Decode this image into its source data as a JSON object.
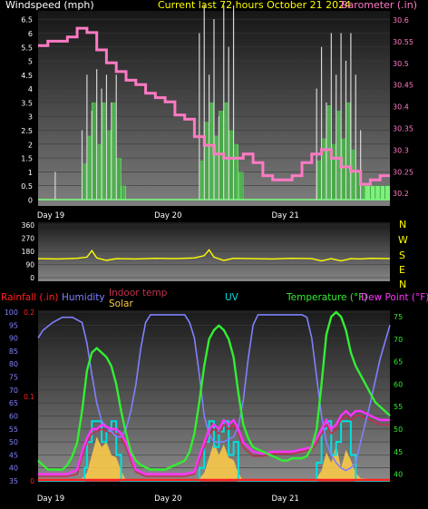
{
  "colors": {
    "wind_label": "#ffffff",
    "title": "#ffff00",
    "barometer": "#ff7ac4",
    "wind_gust": "#d8d8d8",
    "wind_avg": "#7cff7c",
    "direction": "#ffff00",
    "rain": "#ff2020",
    "humidity": "#8080ff",
    "indoor": "#c03050",
    "solar": "#ffcc44",
    "uv": "#00e0e0",
    "temperature": "#33ee33",
    "dewpoint": "#ff33ff"
  },
  "top_chart": {
    "wind_title": "Windspeed (mph)",
    "center_title": "Current last 72 hours October 21 2024",
    "baro_title": "Barometer (.in)"
  },
  "mid_chart": {
    "compass": [
      "N",
      "W",
      "S",
      "E",
      "N"
    ]
  },
  "bottom_chart": {
    "labels": {
      "rain": "Rainfall (.in)",
      "humidity": "Humidity",
      "indoor": "Indoor temp",
      "solar": "Solar",
      "uv": "UV",
      "temperature": "Temperature (°F)",
      "dewpoint": "Dew Point (°F)"
    }
  },
  "chart_data": [
    {
      "type": "line",
      "x_range_hours": [
        0,
        72
      ],
      "day_ticks": [
        {
          "label": "Day 19",
          "hour": 0
        },
        {
          "label": "Day 20",
          "hour": 24
        },
        {
          "label": "Day 21",
          "hour": 48
        }
      ],
      "y_left": {
        "ticks": [
          "0",
          "0.5",
          "1",
          "1.5",
          "2",
          "2.5",
          "3",
          "3.5",
          "4",
          "4.5",
          "5",
          "5.5",
          "6",
          "6.5"
        ],
        "ylim": [
          0,
          6.8
        ]
      },
      "y_right": {
        "ticks": [
          "30.2",
          "30.25",
          "30.3",
          "30.35",
          "30.4",
          "30.45",
          "30.5",
          "30.55",
          "30.6"
        ],
        "ylim": [
          30.17,
          30.62
        ]
      },
      "series": [
        {
          "name": "Barometer",
          "axis": "right",
          "x": [
            0,
            2,
            4,
            6,
            8,
            9,
            10,
            12,
            14,
            16,
            18,
            20,
            22,
            24,
            26,
            28,
            30,
            32,
            34,
            36,
            38,
            40,
            42,
            44,
            46,
            48,
            50,
            52,
            54,
            56,
            58,
            60,
            62,
            64,
            66,
            68,
            70,
            72
          ],
          "values": [
            30.54,
            30.55,
            30.55,
            30.56,
            30.58,
            30.58,
            30.57,
            30.53,
            30.5,
            30.48,
            30.46,
            30.45,
            30.43,
            30.42,
            30.41,
            30.38,
            30.37,
            30.33,
            30.31,
            30.29,
            30.28,
            30.28,
            30.29,
            30.27,
            30.24,
            30.23,
            30.23,
            30.24,
            30.27,
            30.29,
            30.3,
            30.28,
            30.26,
            30.25,
            30.22,
            30.23,
            30.24,
            30.24
          ]
        },
        {
          "name": "Wind average",
          "axis": "left",
          "x": [
            0,
            8,
            9,
            10,
            11,
            12,
            13,
            14,
            15,
            16,
            17,
            18,
            19,
            20,
            32,
            33,
            34,
            35,
            36,
            37,
            38,
            39,
            40,
            41,
            42,
            56,
            57,
            58,
            59,
            60,
            61,
            62,
            63,
            64,
            65,
            66,
            67,
            72
          ],
          "values": [
            0,
            0,
            1.3,
            2.3,
            3.5,
            2.0,
            3.5,
            2.5,
            3.5,
            1.5,
            0.5,
            0,
            0,
            0,
            0,
            1.4,
            2.8,
            3.5,
            2.3,
            3.2,
            3.5,
            2.5,
            2.0,
            1.0,
            0,
            0,
            1.4,
            2.2,
            3.4,
            2.0,
            3.2,
            2.2,
            3.5,
            1.8,
            1.0,
            0.6,
            0.5,
            0
          ]
        },
        {
          "name": "Wind gust",
          "axis": "left",
          "x": [
            3.5,
            9,
            10,
            11,
            12,
            13,
            14,
            15,
            16,
            33,
            34,
            35,
            36,
            37,
            38,
            39,
            40,
            57,
            58,
            59,
            60,
            61,
            62,
            63,
            64,
            65,
            66
          ],
          "values": [
            1.0,
            2.5,
            4.5,
            3.2,
            4.7,
            4.0,
            4.5,
            3.5,
            4.5,
            6.0,
            7.0,
            4.5,
            6.5,
            3.0,
            7.0,
            5.5,
            7.0,
            4.0,
            5.5,
            3.5,
            6.0,
            4.5,
            6.0,
            5.0,
            6.0,
            4.5,
            2.5
          ]
        }
      ]
    },
    {
      "type": "line",
      "x_range_hours": [
        0,
        72
      ],
      "y": {
        "ticks": [
          "360",
          "270",
          "180",
          "90",
          "0"
        ],
        "ylim": [
          0,
          360
        ]
      },
      "series": [
        {
          "name": "Wind direction",
          "x": [
            0,
            4,
            8,
            10,
            11,
            12,
            14,
            16,
            20,
            24,
            28,
            32,
            34,
            35,
            36,
            38,
            40,
            44,
            48,
            52,
            56,
            58,
            60,
            62,
            64,
            66,
            68,
            72
          ],
          "values": [
            130,
            128,
            132,
            140,
            185,
            135,
            118,
            130,
            128,
            132,
            130,
            135,
            150,
            190,
            140,
            118,
            132,
            130,
            128,
            132,
            130,
            115,
            130,
            115,
            130,
            128,
            132,
            130
          ]
        }
      ]
    },
    {
      "type": "line",
      "x_range_hours": [
        0,
        72
      ],
      "y_left": {
        "ticks": [
          "35",
          "40",
          "45",
          "50",
          "55",
          "60",
          "65",
          "70",
          "75",
          "80",
          "85",
          "90",
          "95",
          "100"
        ],
        "ylim": [
          35,
          100
        ]
      },
      "y_right": {
        "ticks": [
          "40",
          "45",
          "50",
          "55",
          "60",
          "65",
          "70",
          "75"
        ],
        "ylim": [
          38.5,
          76
        ]
      },
      "rain_axis": {
        "ticks": [
          "0",
          "0.1",
          "0.2"
        ]
      },
      "series": [
        {
          "name": "Humidity",
          "axis": "left",
          "x": [
            0,
            1,
            3,
            5,
            7,
            9,
            10,
            11,
            12,
            13,
            14,
            16,
            17,
            18,
            19,
            20,
            21,
            22,
            23,
            24,
            26,
            28,
            30,
            31,
            32,
            33,
            34,
            35,
            36,
            38,
            40,
            41,
            42,
            43,
            44,
            45,
            46,
            47,
            48,
            50,
            52,
            54,
            55,
            56,
            57,
            58,
            59,
            60,
            61,
            62,
            63,
            64,
            65,
            66,
            68,
            70,
            72
          ],
          "values": [
            90,
            93,
            96,
            98,
            98,
            96,
            88,
            76,
            65,
            58,
            56,
            52,
            52,
            55,
            62,
            72,
            86,
            96,
            99,
            99,
            99,
            99,
            99,
            96,
            90,
            76,
            60,
            53,
            50,
            50,
            52,
            56,
            66,
            82,
            95,
            99,
            99,
            99,
            99,
            99,
            99,
            99,
            98,
            90,
            75,
            60,
            50,
            45,
            42,
            40,
            39,
            40,
            42,
            50,
            65,
            82,
            95
          ]
        },
        {
          "name": "Temperature",
          "axis": "right",
          "x": [
            0,
            1,
            2,
            3,
            4,
            5,
            6,
            7,
            8,
            9,
            10,
            11,
            12,
            13,
            14,
            15,
            16,
            17,
            18,
            19,
            20,
            21,
            22,
            23,
            24,
            25,
            26,
            27,
            28,
            29,
            30,
            31,
            32,
            33,
            34,
            35,
            36,
            37,
            38,
            39,
            40,
            41,
            42,
            43,
            44,
            45,
            46,
            47,
            48,
            49,
            50,
            51,
            52,
            53,
            54,
            55,
            56,
            57,
            58,
            59,
            60,
            61,
            62,
            63,
            64,
            65,
            66,
            67,
            68,
            69,
            70,
            71,
            72
          ],
          "values": [
            43,
            42,
            41,
            41,
            41,
            41,
            42,
            44,
            47,
            54,
            63,
            67,
            68,
            67,
            66,
            64,
            60,
            54,
            49,
            45,
            43,
            42,
            41.5,
            41,
            41,
            41,
            41,
            41.5,
            42,
            42.5,
            43,
            45,
            49,
            56,
            64,
            70,
            72,
            73,
            72,
            70,
            66,
            58,
            51,
            48,
            46,
            45.5,
            45,
            44.5,
            44,
            43.5,
            43,
            43,
            43.5,
            43.5,
            43.5,
            44,
            46,
            50,
            60,
            71,
            75,
            76,
            75,
            72,
            67,
            64,
            62,
            60,
            58,
            56,
            55,
            54,
            53
          ]
        },
        {
          "name": "Dew Point",
          "axis": "right",
          "x": [
            0,
            2,
            4,
            6,
            8,
            9,
            10,
            11,
            12,
            13,
            14,
            15,
            16,
            17,
            18,
            19,
            20,
            22,
            24,
            26,
            28,
            30,
            32,
            33,
            34,
            35,
            36,
            37,
            38,
            39,
            40,
            41,
            42,
            44,
            46,
            48,
            50,
            52,
            54,
            56,
            57,
            58,
            59,
            60,
            61,
            62,
            63,
            64,
            65,
            66,
            68,
            70,
            72
          ],
          "values": [
            40,
            40,
            40,
            40,
            41,
            45,
            48,
            50,
            50,
            51,
            50.5,
            50,
            50,
            49,
            47,
            44,
            41,
            40,
            40,
            40,
            40,
            40,
            40.5,
            44,
            47,
            50,
            51,
            50,
            52,
            51,
            52,
            50,
            47,
            45,
            44.5,
            45,
            45,
            45,
            45.5,
            46,
            48,
            50,
            52,
            50,
            51,
            53,
            54,
            53,
            54,
            54,
            53,
            52,
            52
          ]
        },
        {
          "name": "Indoor temp",
          "axis": "right",
          "x": [
            0,
            2,
            4,
            6,
            8,
            9,
            10,
            11,
            12,
            13,
            14,
            15,
            16,
            17,
            18,
            19,
            20,
            22,
            24,
            26,
            28,
            30,
            32,
            33,
            34,
            35,
            36,
            37,
            38,
            39,
            40,
            41,
            42,
            44,
            46,
            48,
            50,
            52,
            54,
            56,
            57,
            58,
            59,
            60,
            61,
            62,
            63,
            64,
            65,
            66,
            68,
            70,
            72
          ],
          "values": [
            39.5,
            39.5,
            39.5,
            39.5,
            40,
            44,
            47,
            49,
            49.5,
            50,
            49.5,
            49,
            49,
            48,
            46,
            43,
            40.5,
            39.5,
            39.5,
            39.5,
            39.5,
            39.5,
            40,
            43,
            46,
            49,
            50,
            49,
            51,
            50,
            51,
            49,
            46,
            44,
            44,
            44.5,
            44.5,
            44.5,
            45,
            45.5,
            47,
            49,
            51,
            49,
            50,
            52,
            53,
            52,
            53,
            53,
            52,
            51,
            51
          ]
        },
        {
          "name": "Solar",
          "axis": "left",
          "x": [
            0,
            8,
            9,
            10,
            11,
            12,
            13,
            14,
            15,
            16,
            17,
            18,
            32,
            33,
            34,
            35,
            36,
            37,
            38,
            39,
            40,
            41,
            42,
            56,
            57,
            58,
            59,
            60,
            61,
            62,
            63,
            64,
            65,
            66,
            72
          ],
          "values": [
            35,
            35,
            36,
            38,
            45,
            52,
            48,
            50,
            45,
            44,
            39,
            35,
            35,
            36,
            38,
            44,
            50,
            45,
            49,
            44,
            43,
            38,
            35,
            35,
            36,
            39,
            46,
            42,
            49,
            40,
            47,
            43,
            38,
            36,
            35
          ]
        },
        {
          "name": "UV",
          "axis": "left",
          "x": [
            0,
            9,
            9.5,
            10,
            11,
            12,
            13,
            14,
            15,
            16,
            17,
            32,
            33,
            34,
            35,
            36,
            37,
            38,
            39,
            40,
            41,
            56,
            57,
            58,
            59,
            60,
            61,
            62,
            63,
            64,
            65,
            72
          ],
          "values": [
            35,
            35,
            40,
            50,
            58,
            58,
            50,
            54,
            58,
            45,
            35,
            35,
            40,
            50,
            58,
            48,
            54,
            58,
            45,
            50,
            35,
            35,
            42,
            55,
            58,
            45,
            50,
            58,
            58,
            45,
            35,
            35
          ]
        },
        {
          "name": "Rainfall",
          "axis": "rain",
          "x": [
            0,
            72
          ],
          "values": [
            0,
            0
          ]
        }
      ]
    }
  ]
}
